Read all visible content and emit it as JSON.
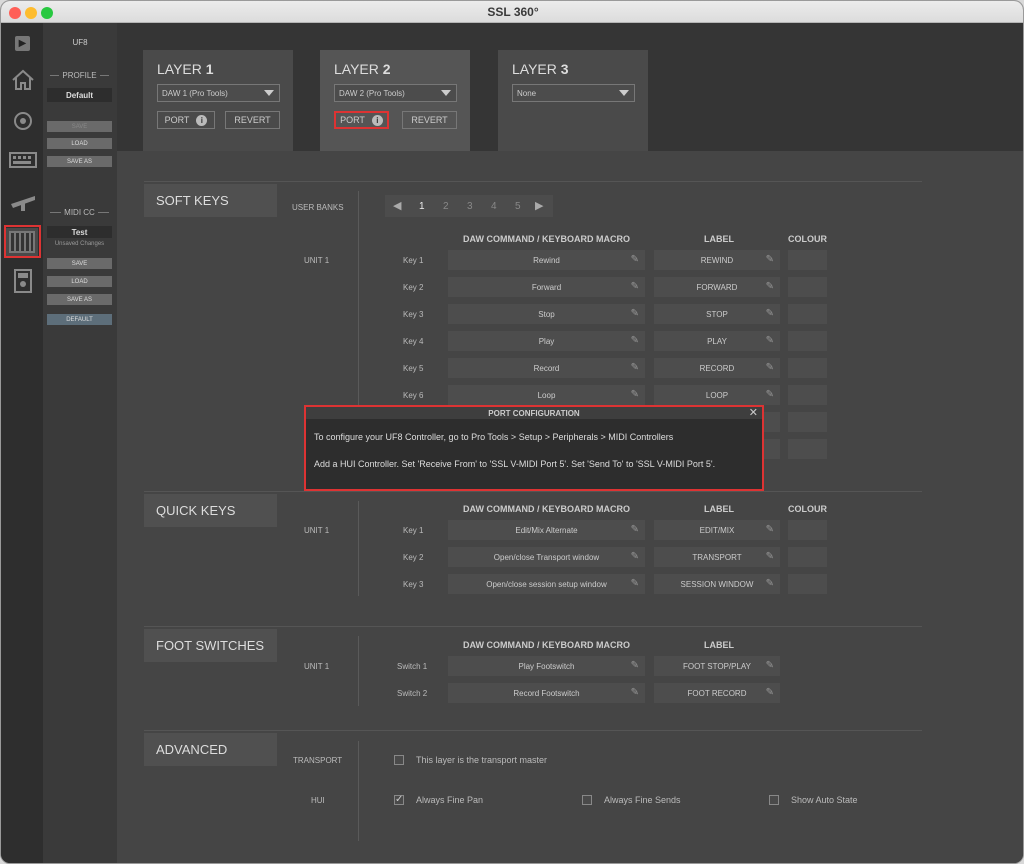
{
  "window": {
    "title": "SSL 360°"
  },
  "sidebar": {
    "device": "UF8",
    "profile": {
      "heading": "PROFILE",
      "name": "Default",
      "save": "SAVE",
      "load": "LOAD",
      "save_as": "SAVE AS"
    },
    "midi_cc": {
      "heading": "MIDI CC",
      "name": "Test",
      "status": "Unsaved Changes",
      "save": "SAVE",
      "load": "LOAD",
      "save_as": "SAVE AS",
      "default": "DEFAULT"
    }
  },
  "layers": [
    {
      "title_pre": "LAYER ",
      "title_num": "1",
      "daw": "DAW 1 (Pro Tools)",
      "port": "PORT",
      "revert": "REVERT"
    },
    {
      "title_pre": "LAYER ",
      "title_num": "2",
      "daw": "DAW 2 (Pro Tools)",
      "port": "PORT",
      "revert": "REVERT"
    },
    {
      "title_pre": "LAYER ",
      "title_num": "3",
      "daw": "None"
    }
  ],
  "soft_keys": {
    "title": "SOFT KEYS",
    "user_banks": "USER BANKS",
    "banks": [
      "1",
      "2",
      "3",
      "4",
      "5"
    ],
    "col_cmd": "DAW COMMAND / KEYBOARD MACRO",
    "col_label": "LABEL",
    "col_colour": "COLOUR",
    "unit": "UNIT 1",
    "rows": [
      {
        "key": "Key 1",
        "cmd": "Rewind",
        "label": "REWIND"
      },
      {
        "key": "Key 2",
        "cmd": "Forward",
        "label": "FORWARD"
      },
      {
        "key": "Key 3",
        "cmd": "Stop",
        "label": "STOP"
      },
      {
        "key": "Key 4",
        "cmd": "Play",
        "label": "PLAY"
      },
      {
        "key": "Key 5",
        "cmd": "Record",
        "label": "RECORD"
      },
      {
        "key": "Key 6",
        "cmd": "Loop",
        "label": "LOOP"
      }
    ]
  },
  "quick_keys": {
    "title": "QUICK KEYS",
    "col_cmd": "DAW COMMAND / KEYBOARD MACRO",
    "col_label": "LABEL",
    "col_colour": "COLOUR",
    "unit": "UNIT 1",
    "rows": [
      {
        "key": "Key 1",
        "cmd": "Edit/Mix Alternate",
        "label": "EDIT/MIX"
      },
      {
        "key": "Key 2",
        "cmd": "Open/close Transport window",
        "label": "TRANSPORT"
      },
      {
        "key": "Key 3",
        "cmd": "Open/close session setup window",
        "label": "SESSION WINDOW"
      }
    ]
  },
  "foot_switches": {
    "title": "FOOT SWITCHES",
    "col_cmd": "DAW COMMAND / KEYBOARD MACRO",
    "col_label": "LABEL",
    "unit": "UNIT 1",
    "rows": [
      {
        "key": "Switch 1",
        "cmd": "Play Footswitch",
        "label": "FOOT STOP/PLAY"
      },
      {
        "key": "Switch 2",
        "cmd": "Record Footswitch",
        "label": "FOOT RECORD"
      }
    ]
  },
  "advanced": {
    "title": "ADVANCED",
    "transport_label": "TRANSPORT",
    "transport_master": "This layer is the transport master",
    "hui_label": "HUI",
    "fine_pan": "Always Fine Pan",
    "fine_sends": "Always Fine Sends",
    "auto_state": "Show Auto State"
  },
  "modal": {
    "title": "PORT CONFIGURATION",
    "line1": "To configure your UF8 Controller, go to Pro Tools > Setup > Peripherals > MIDI Controllers",
    "line2": "Add a HUI Controller. Set 'Receive From' to 'SSL V-MIDI Port 5'. Set 'Send To' to 'SSL V-MIDI Port 5'.",
    "close": "✕"
  },
  "colors": {
    "highlight": "#dd3333",
    "bg": "#454545"
  }
}
